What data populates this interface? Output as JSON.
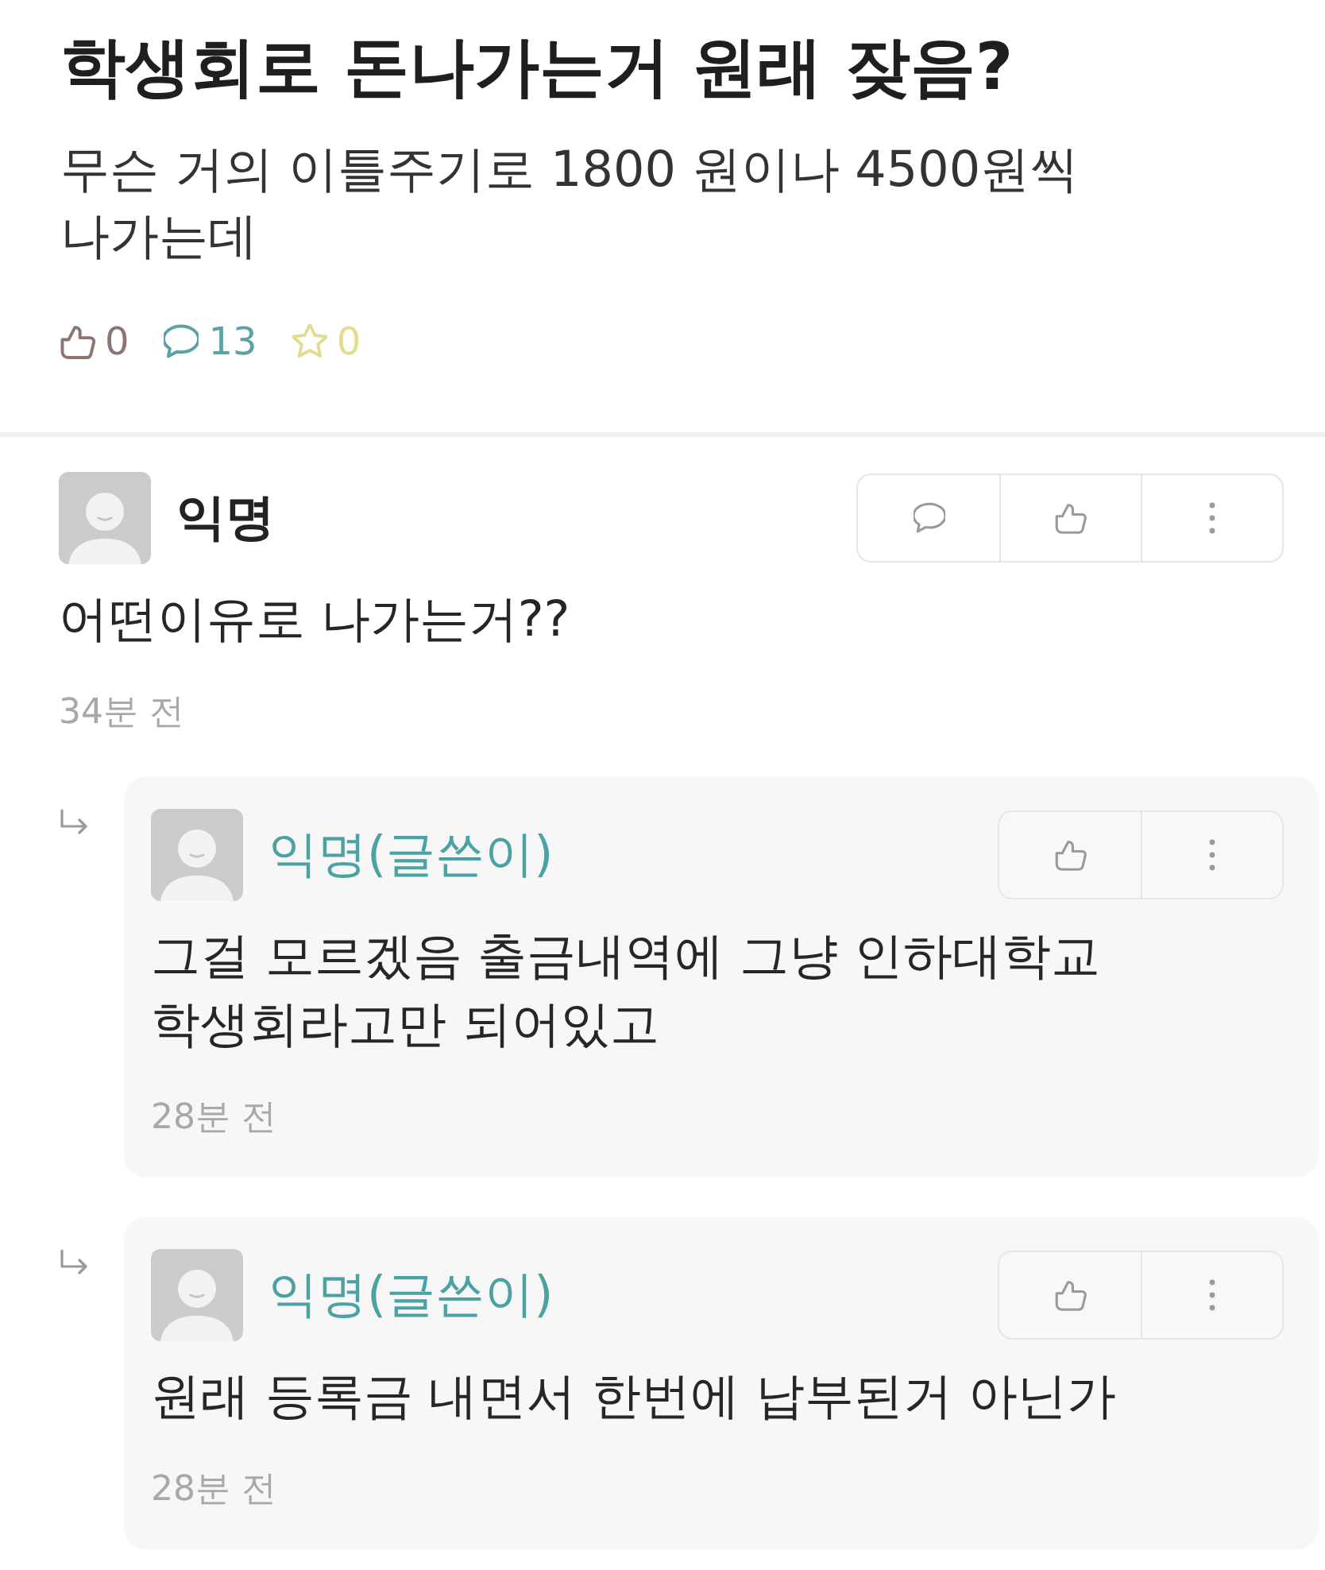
{
  "post": {
    "title": "학생회로 돈나가는거 원래 잦음?",
    "body": "무슨 거의 이틀주기로 1800 원이나 4500원씩\n나가는데",
    "stats": [
      {
        "kind": "like",
        "count": "0",
        "color": "#8d7473"
      },
      {
        "kind": "comment",
        "count": "13",
        "color": "#5aa2a6"
      },
      {
        "kind": "scrap",
        "count": "0",
        "color": "#e2dc8e"
      }
    ]
  },
  "comments": [
    {
      "author": "익명",
      "writer": false,
      "actions": [
        {
          "kind": "comment"
        },
        {
          "kind": "like"
        },
        {
          "kind": "more"
        }
      ],
      "text": "어떤이유로 나가는거??",
      "time": "34분 전",
      "replies": [
        {
          "author": "익명(글쓴이)",
          "writer": true,
          "actions": [
            {
              "kind": "like"
            },
            {
              "kind": "more"
            }
          ],
          "text": "그걸 모르겠음 출금내역에 그냥 인하대학교\n학생회라고만 되어있고",
          "time": "28분 전"
        },
        {
          "author": "익명(글쓴이)",
          "writer": true,
          "actions": [
            {
              "kind": "like"
            },
            {
              "kind": "more"
            }
          ],
          "text": "원래 등록금 내면서 한번에 납부된거 아닌가",
          "time": "28분 전"
        }
      ]
    }
  ]
}
